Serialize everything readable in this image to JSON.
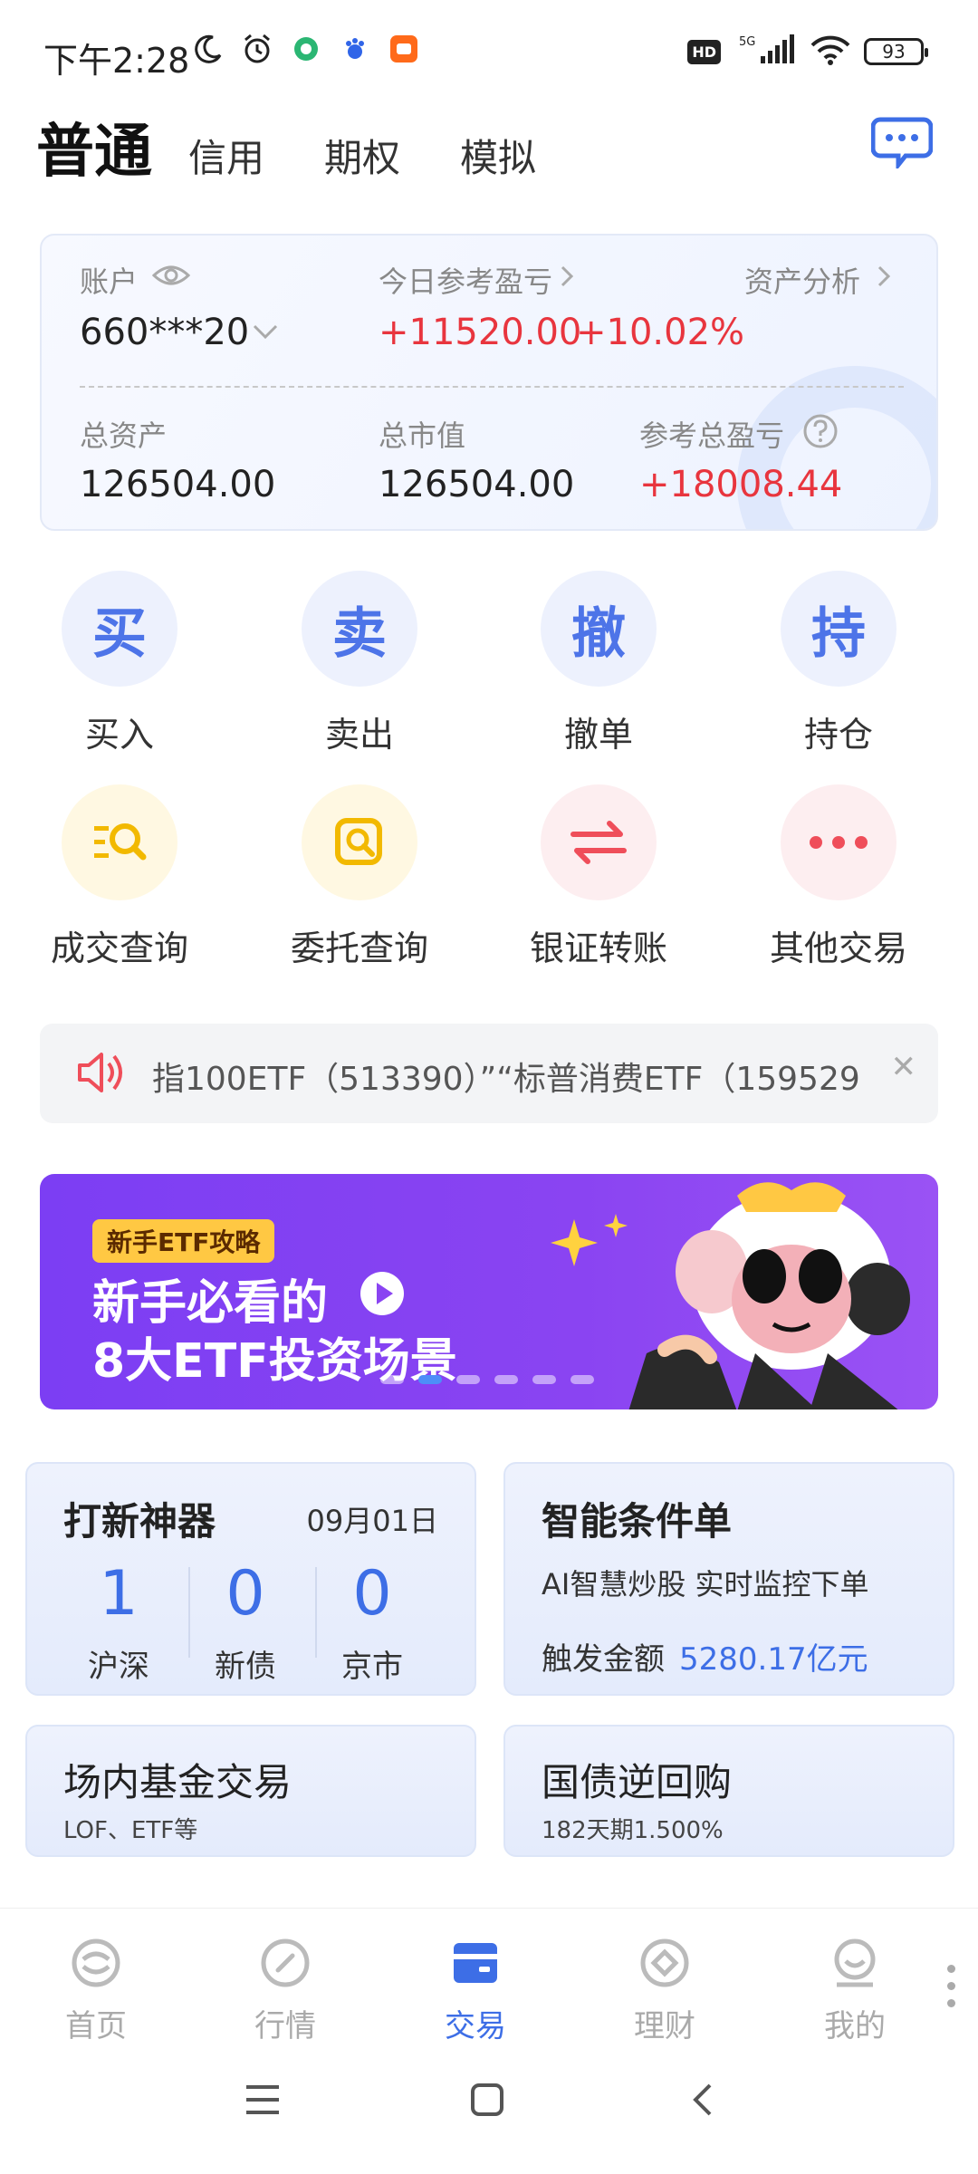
{
  "status_bar": {
    "time": "下午2:28",
    "network": "5G",
    "battery": "93"
  },
  "top_tabs": {
    "active": "普通",
    "items": [
      "信用",
      "期权",
      "模拟"
    ]
  },
  "account": {
    "label": "账户",
    "number": "660***20",
    "today_pl_label": "今日参考盈亏",
    "today_pl_value": "+11520.00",
    "today_pl_pct": "+10.02%",
    "analysis_label": "资产分析",
    "total_assets_label": "总资产",
    "total_assets_value": "126504.00",
    "market_value_label": "总市值",
    "market_value_value": "126504.00",
    "total_pl_label": "参考总盈亏",
    "total_pl_value": "+18008.44"
  },
  "quick_actions": {
    "buy_char": "买",
    "buy_label": "买入",
    "sell_char": "卖",
    "sell_label": "卖出",
    "cancel_char": "撤",
    "cancel_label": "撤单",
    "hold_char": "持",
    "hold_label": "持仓",
    "deal_query": "成交查询",
    "order_query": "委托查询",
    "bank_transfer": "银证转账",
    "other_trade": "其他交易"
  },
  "notice": {
    "text": "指100ETF（513390）”“标普消费ETF（159529"
  },
  "banner": {
    "tag": "新手ETF攻略",
    "line1": "新手必看的",
    "line2": "8大ETF投资场景",
    "active_slide": 2,
    "total_slides": 6
  },
  "ipo_card": {
    "title": "打新神器",
    "date": "09月01日",
    "items": [
      {
        "count": "1",
        "label": "沪深"
      },
      {
        "count": "0",
        "label": "新债"
      },
      {
        "count": "0",
        "label": "京市"
      }
    ]
  },
  "smart_order_card": {
    "title": "智能条件单",
    "subtitle": "AI智慧炒股 实时监控下单",
    "trigger_label": "触发金额",
    "trigger_value": "5280.17亿元"
  },
  "fund_card": {
    "title": "场内基金交易",
    "subtitle": "LOF、ETF等"
  },
  "repo_card": {
    "title": "国债逆回购",
    "subtitle": "182天期1.500%"
  },
  "bottom_nav": {
    "home": "首页",
    "market": "行情",
    "trade": "交易",
    "wealth": "理财",
    "mine": "我的"
  },
  "colors": {
    "accent_blue": "#3d6ee6",
    "profit_red": "#e8353e",
    "banner_purple": "#8a44f2"
  }
}
